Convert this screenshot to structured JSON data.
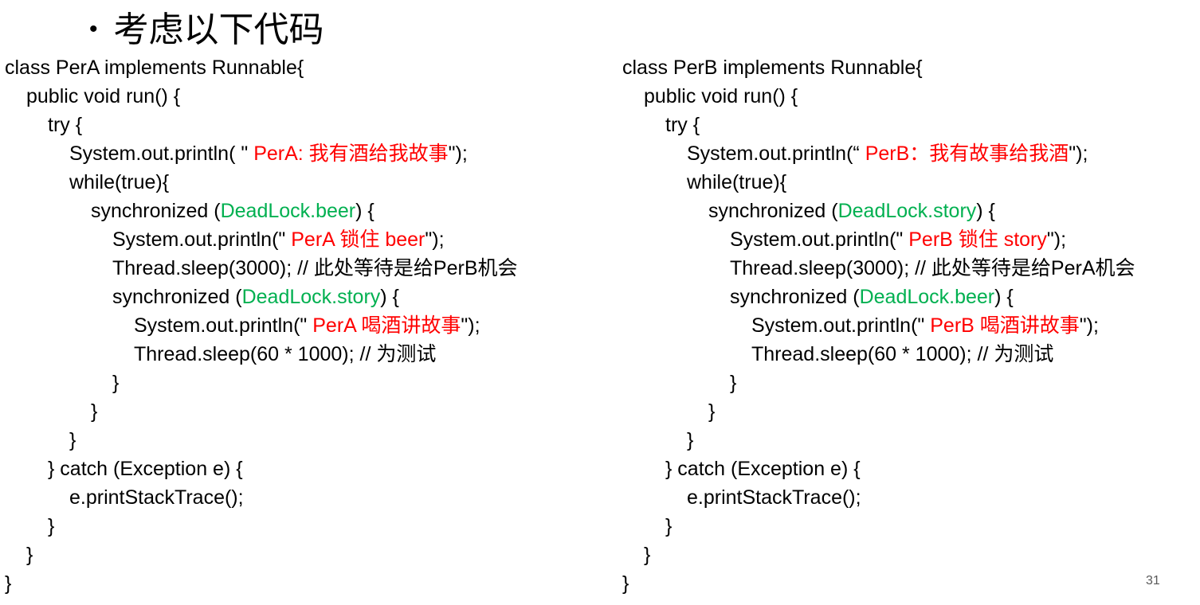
{
  "title": {
    "bullet": "•",
    "text": "考虑以下代码"
  },
  "colors": {
    "red": "#ff0000",
    "green": "#00b050"
  },
  "code_left": [
    {
      "indent": 0,
      "segs": [
        {
          "t": "class PerA implements Runnable{"
        }
      ]
    },
    {
      "indent": 1,
      "segs": [
        {
          "t": "public void run() {"
        }
      ]
    },
    {
      "indent": 2,
      "segs": [
        {
          "t": "try {"
        }
      ]
    },
    {
      "indent": 3,
      "segs": [
        {
          "t": "System.out.println( \" "
        },
        {
          "t": "PerA: 我有酒给我故事",
          "c": "red"
        },
        {
          "t": "\");"
        }
      ]
    },
    {
      "indent": 3,
      "segs": [
        {
          "t": "while(true){"
        }
      ]
    },
    {
      "indent": 4,
      "segs": [
        {
          "t": "synchronized ("
        },
        {
          "t": "DeadLock.beer",
          "c": "green"
        },
        {
          "t": ") {"
        }
      ]
    },
    {
      "indent": 5,
      "segs": [
        {
          "t": "System.out.println(\" "
        },
        {
          "t": "PerA 锁住 beer",
          "c": "red"
        },
        {
          "t": "\");"
        }
      ]
    },
    {
      "indent": 5,
      "segs": [
        {
          "t": "Thread.sleep(3000); // 此处等待是给PerB机会"
        }
      ]
    },
    {
      "indent": 5,
      "segs": [
        {
          "t": "synchronized ("
        },
        {
          "t": "DeadLock.story",
          "c": "green"
        },
        {
          "t": ") {"
        }
      ]
    },
    {
      "indent": 6,
      "segs": [
        {
          "t": "System.out.println(\" "
        },
        {
          "t": "PerA 喝酒讲故事",
          "c": "red"
        },
        {
          "t": "\");"
        }
      ]
    },
    {
      "indent": 6,
      "segs": [
        {
          "t": "Thread.sleep(60 * 1000); // 为测试"
        }
      ]
    },
    {
      "indent": 5,
      "segs": [
        {
          "t": "}"
        }
      ]
    },
    {
      "indent": 4,
      "segs": [
        {
          "t": "}"
        }
      ]
    },
    {
      "indent": 3,
      "segs": [
        {
          "t": "}"
        }
      ]
    },
    {
      "indent": 2,
      "segs": [
        {
          "t": "} catch (Exception e) {"
        }
      ]
    },
    {
      "indent": 3,
      "segs": [
        {
          "t": "e.printStackTrace();"
        }
      ]
    },
    {
      "indent": 2,
      "segs": [
        {
          "t": "}"
        }
      ]
    },
    {
      "indent": 1,
      "segs": [
        {
          "t": "}"
        }
      ]
    },
    {
      "indent": 0,
      "segs": [
        {
          "t": "}"
        }
      ]
    }
  ],
  "code_right": [
    {
      "indent": 0,
      "segs": [
        {
          "t": "class PerB implements Runnable{"
        }
      ]
    },
    {
      "indent": 1,
      "segs": [
        {
          "t": "public void run() {"
        }
      ]
    },
    {
      "indent": 2,
      "segs": [
        {
          "t": "try {"
        }
      ]
    },
    {
      "indent": 3,
      "segs": [
        {
          "t": "System.out.println(“ "
        },
        {
          "t": "PerB：我有故事给我酒",
          "c": "red"
        },
        {
          "t": "\");"
        }
      ]
    },
    {
      "indent": 3,
      "segs": [
        {
          "t": "while(true){"
        }
      ]
    },
    {
      "indent": 4,
      "segs": [
        {
          "t": "synchronized ("
        },
        {
          "t": "DeadLock.story",
          "c": "green"
        },
        {
          "t": ") {"
        }
      ]
    },
    {
      "indent": 5,
      "segs": [
        {
          "t": "System.out.println(\" "
        },
        {
          "t": "PerB 锁住 story",
          "c": "red"
        },
        {
          "t": "\");"
        }
      ]
    },
    {
      "indent": 5,
      "segs": [
        {
          "t": "Thread.sleep(3000); // 此处等待是给PerA机会"
        }
      ]
    },
    {
      "indent": 5,
      "segs": [
        {
          "t": "synchronized ("
        },
        {
          "t": "DeadLock.beer",
          "c": "green"
        },
        {
          "t": ") {"
        }
      ]
    },
    {
      "indent": 6,
      "segs": [
        {
          "t": "System.out.println(\" "
        },
        {
          "t": "PerB 喝酒讲故事",
          "c": "red"
        },
        {
          "t": "\");"
        }
      ]
    },
    {
      "indent": 6,
      "segs": [
        {
          "t": "Thread.sleep(60 * 1000); // 为测试"
        }
      ]
    },
    {
      "indent": 5,
      "segs": [
        {
          "t": "}"
        }
      ]
    },
    {
      "indent": 4,
      "segs": [
        {
          "t": "}"
        }
      ]
    },
    {
      "indent": 3,
      "segs": [
        {
          "t": "}"
        }
      ]
    },
    {
      "indent": 2,
      "segs": [
        {
          "t": "} catch (Exception e) {"
        }
      ]
    },
    {
      "indent": 3,
      "segs": [
        {
          "t": "e.printStackTrace();"
        }
      ]
    },
    {
      "indent": 2,
      "segs": [
        {
          "t": "}"
        }
      ]
    },
    {
      "indent": 1,
      "segs": [
        {
          "t": "}"
        }
      ]
    },
    {
      "indent": 0,
      "segs": [
        {
          "t": "}"
        }
      ]
    }
  ],
  "page_number": "31"
}
